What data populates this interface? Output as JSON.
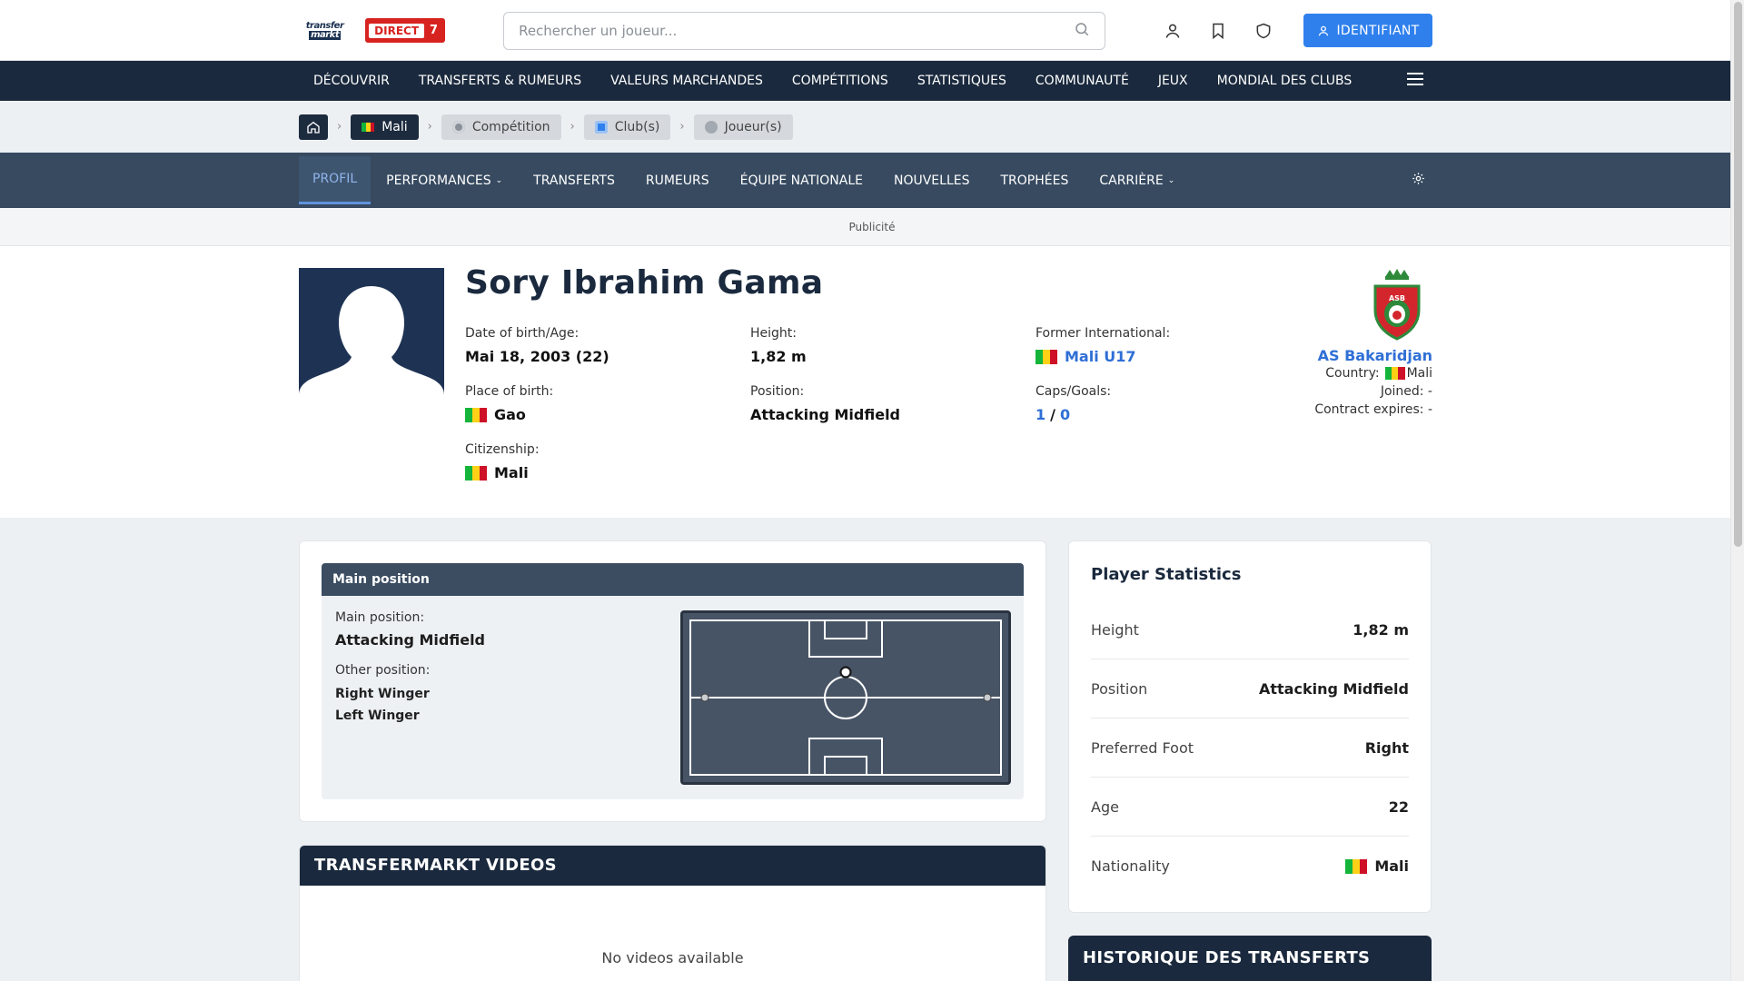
{
  "header": {
    "logo_top": "transfer",
    "logo_bottom": "markt",
    "live_label": "DIRECT",
    "live_count": "7",
    "search_placeholder": "Rechercher un joueur...",
    "login_label": "IDENTIFIANT"
  },
  "main_nav": [
    "DÉCOUVRIR",
    "TRANSFERTS & RUMEURS",
    "VALEURS MARCHANDES",
    "COMPÉTITIONS",
    "STATISTIQUES",
    "COMMUNAUTÉ",
    "JEUX",
    "MONDIAL DES CLUBS"
  ],
  "breadcrumb": {
    "country": "Mali",
    "competition": "Compétition",
    "clubs": "Club(s)",
    "players": "Joueur(s)"
  },
  "sub_nav": [
    {
      "label": "PROFIL",
      "active": true,
      "dropdown": false
    },
    {
      "label": "PERFORMANCES",
      "dropdown": true
    },
    {
      "label": "TRANSFERTS",
      "dropdown": false
    },
    {
      "label": "RUMEURS",
      "dropdown": false
    },
    {
      "label": "ÉQUIPE NATIONALE",
      "dropdown": false
    },
    {
      "label": "NOUVELLES",
      "dropdown": false
    },
    {
      "label": "TROPHÉES",
      "dropdown": false
    },
    {
      "label": "CARRIÈRE",
      "dropdown": true
    }
  ],
  "ad_label": "Publicité",
  "player": {
    "name": "Sory Ibrahim Gama",
    "dob_label": "Date of birth/Age:",
    "dob_value": "Mai 18, 2003 (22)",
    "height_label": "Height:",
    "height_value": "1,82 m",
    "intl_label": "Former International:",
    "intl_value": "Mali U17",
    "pob_label": "Place of birth:",
    "pob_value": "Gao",
    "position_label": "Position:",
    "position_value": "Attacking Midfield",
    "caps_label": "Caps/Goals:",
    "caps": "1",
    "caps_sep": "/",
    "goals": "0",
    "citizenship_label": "Citizenship:",
    "citizenship_value": "Mali"
  },
  "club": {
    "crest_text": "ASB",
    "name": "AS Bakaridjan",
    "country_label": "Country:",
    "country_value": "Mali",
    "joined": "Joined: -",
    "contract": "Contract expires: -"
  },
  "position_card": {
    "title": "Main position",
    "main_label": "Main position:",
    "main_value": "Attacking Midfield",
    "other_label": "Other position:",
    "others": [
      "Right Winger",
      "Left Winger"
    ]
  },
  "videos": {
    "title": "TRANSFERMARKT VIDEOS",
    "empty": "No videos available"
  },
  "stats": {
    "title": "Player Statistics",
    "rows": [
      {
        "k": "Height",
        "v": "1,82 m"
      },
      {
        "k": "Position",
        "v": "Attacking Midfield"
      },
      {
        "k": "Preferred Foot",
        "v": "Right"
      },
      {
        "k": "Age",
        "v": "22"
      },
      {
        "k": "Nationality",
        "v": "Mali",
        "flag": true
      }
    ]
  },
  "history_title": "HISTORIQUE DES TRANSFERTS",
  "colors": {
    "nav_dark": "#1a293d",
    "sub_nav": "#374a60",
    "accent_blue": "#2f80ed",
    "live_red": "#d7231f",
    "link": "#2f6fd6"
  }
}
